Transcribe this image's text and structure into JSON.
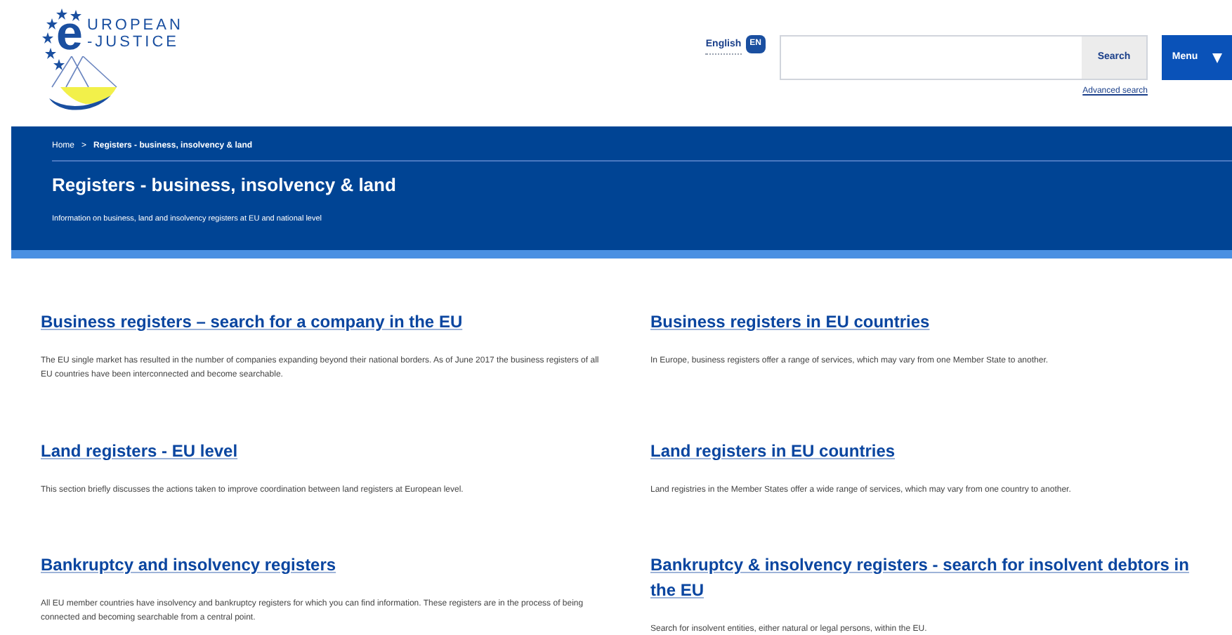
{
  "logo": {
    "initial": "e",
    "line_1": "UROPEAN",
    "line_2": "-JUSTICE"
  },
  "language": {
    "label": "English",
    "code": "EN"
  },
  "search": {
    "button": "Search",
    "advanced_link": "Advanced search"
  },
  "menu_button": "Menu",
  "breadcrumb": [
    "Home",
    ">",
    "Registers - business, insolvency & land"
  ],
  "page_title": "Registers - business, insolvency & land",
  "page_subtitle": "Information on business, land and insolvency registers at EU and national level",
  "sections": [
    {
      "title": "Business registers – search for a company in the EU",
      "description": "The EU single market has resulted in the number of companies expanding beyond their national borders. As of June 2017 the business registers of all EU countries have been interconnected and become searchable."
    },
    {
      "title": "Business registers in EU countries",
      "description": "In Europe, business registers offer a range of services, which may vary from one Member State to another."
    },
    {
      "title": "Land registers - EU level",
      "description": "This section briefly discusses the actions taken to improve coordination between land registers at European level."
    },
    {
      "title": "Land registers in EU countries",
      "description": "Land registries in the Member States offer a wide range of services, which may vary from one country to another."
    },
    {
      "title": "Bankruptcy and insolvency registers",
      "description": "All EU member countries have insolvency and bankruptcy registers for which you can find information. These registers are in the process of being connected and becoming searchable from a central point."
    },
    {
      "title": "Bankruptcy & insolvency registers - search for insolvent debtors in the EU",
      "description": "Search for insolvent entities, either natural or legal persons, within the EU."
    }
  ]
}
